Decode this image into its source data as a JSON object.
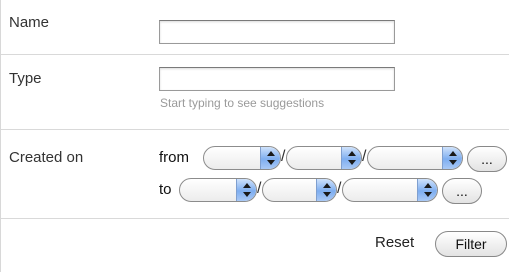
{
  "fields": {
    "name": {
      "label": "Name",
      "value": ""
    },
    "type": {
      "label": "Type",
      "value": "",
      "hint": "Start typing to see suggestions"
    },
    "created_on": {
      "label": "Created on",
      "from_label": "from",
      "to_label": "to",
      "separator": "/",
      "from_values": [
        "",
        "",
        ""
      ],
      "to_values": [
        "",
        "",
        ""
      ],
      "picker_label": "..."
    }
  },
  "actions": {
    "reset_label": "Reset",
    "filter_label": "Filter"
  },
  "colors": {
    "select_arrow": "#7eaef0",
    "hint_text": "#9a9a9a",
    "divider": "#d9d9d9"
  }
}
